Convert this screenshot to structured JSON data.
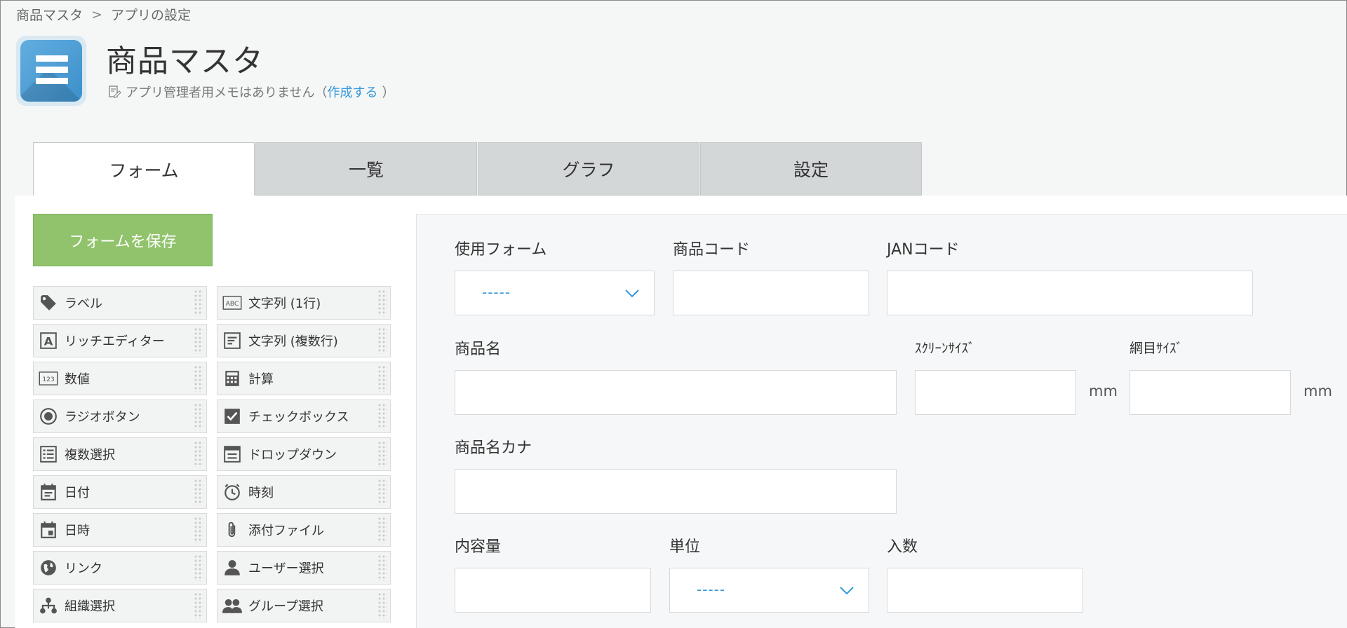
{
  "breadcrumb": {
    "root": "商品マスタ",
    "separator": ">",
    "current": "アプリの設定"
  },
  "header": {
    "title": "商品マスタ",
    "memo_text": "アプリ管理者用メモはありません（",
    "memo_link": "作成する",
    "memo_close": "）"
  },
  "tabs": [
    "フォーム",
    "一覧",
    "グラフ",
    "設定"
  ],
  "palette": {
    "save_label": "フォームを保存",
    "items": [
      {
        "label": "ラベル",
        "icon": "tag-icon"
      },
      {
        "label": "文字列 (1行)",
        "icon": "abc-icon"
      },
      {
        "label": "リッチエディター",
        "icon": "rich-editor-icon"
      },
      {
        "label": "文字列 (複数行)",
        "icon": "multiline-text-icon"
      },
      {
        "label": "数値",
        "icon": "number-icon"
      },
      {
        "label": "計算",
        "icon": "calculator-icon"
      },
      {
        "label": "ラジオボタン",
        "icon": "radio-icon"
      },
      {
        "label": "チェックボックス",
        "icon": "checkbox-icon"
      },
      {
        "label": "複数選択",
        "icon": "multi-select-icon"
      },
      {
        "label": "ドロップダウン",
        "icon": "dropdown-icon"
      },
      {
        "label": "日付",
        "icon": "calendar-icon"
      },
      {
        "label": "時刻",
        "icon": "clock-icon"
      },
      {
        "label": "日時",
        "icon": "datetime-icon"
      },
      {
        "label": "添付ファイル",
        "icon": "paperclip-icon"
      },
      {
        "label": "リンク",
        "icon": "globe-icon"
      },
      {
        "label": "ユーザー選択",
        "icon": "user-icon"
      },
      {
        "label": "組織選択",
        "icon": "org-icon"
      },
      {
        "label": "グループ選択",
        "icon": "group-icon"
      }
    ]
  },
  "form": {
    "use_form_label": "使用フォーム",
    "use_form_value": "-----",
    "product_code_label": "商品コード",
    "jan_code_label": "JANコード",
    "product_name_label": "商品名",
    "screen_size_label": "ｽｸﾘｰﾝｻｲｽﾞ",
    "screen_size_unit": "mm",
    "net_size_label": "網目ｻｲｽﾞ",
    "net_size_unit": "mm",
    "product_name_kana_label": "商品名カナ",
    "content_amount_label": "内容量",
    "unit_label": "単位",
    "unit_value": "-----",
    "quantity_label": "入数"
  }
}
